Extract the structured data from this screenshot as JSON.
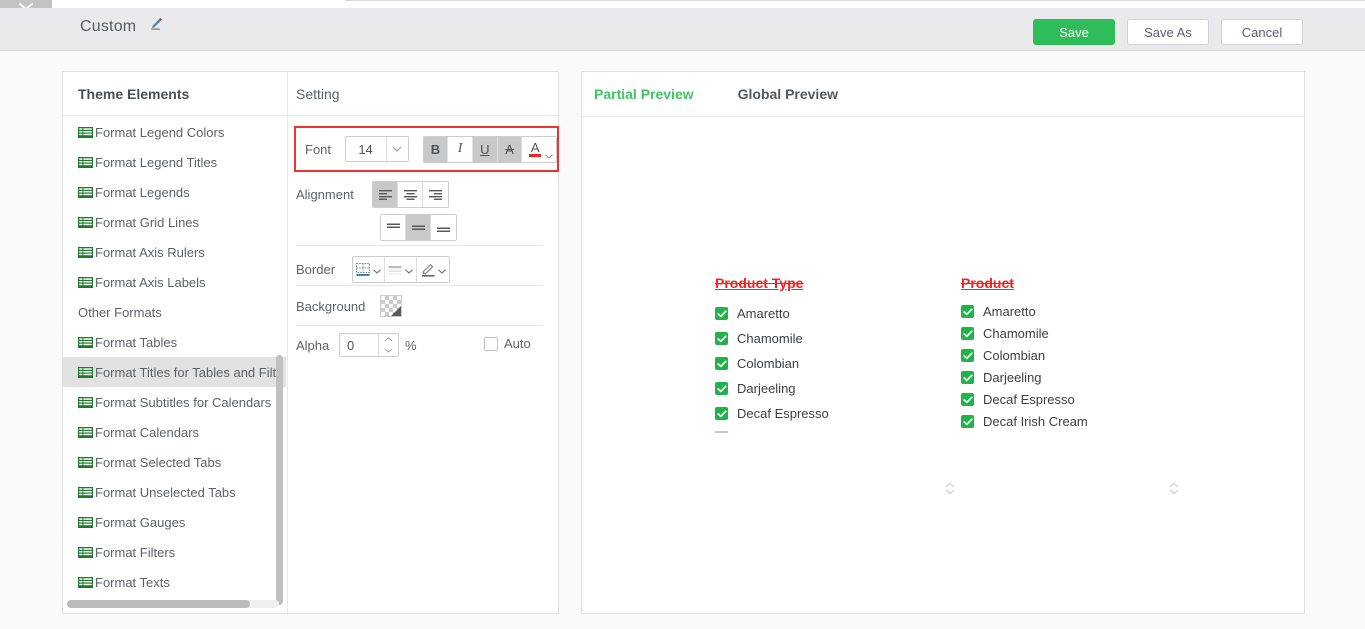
{
  "window": {
    "ghost_tab_icon": "chevron-down-icon"
  },
  "header": {
    "title": "Custom",
    "edit_icon": "pencil-icon",
    "buttons": {
      "save": "Save",
      "save_as": "Save As",
      "cancel": "Cancel"
    },
    "accent_green": "#2ebd59"
  },
  "left_panel": {
    "theme_header": "Theme Elements",
    "setting_header": "Setting",
    "items": [
      {
        "label": "Format Legend Colors",
        "icon": "list-format-icon",
        "selected": false,
        "has_icon": true
      },
      {
        "label": "Format Legend Titles",
        "icon": "list-format-icon",
        "selected": false,
        "has_icon": true
      },
      {
        "label": "Format Legends",
        "icon": "list-format-icon",
        "selected": false,
        "has_icon": true
      },
      {
        "label": "Format Grid Lines",
        "icon": "list-format-icon",
        "selected": false,
        "has_icon": true
      },
      {
        "label": "Format Axis Rulers",
        "icon": "list-format-icon",
        "selected": false,
        "has_icon": true
      },
      {
        "label": "Format Axis Labels",
        "icon": "list-format-icon",
        "selected": false,
        "has_icon": true
      },
      {
        "label": "Other Formats",
        "icon": "",
        "selected": false,
        "has_icon": false
      },
      {
        "label": "Format Tables",
        "icon": "list-format-icon",
        "selected": false,
        "has_icon": true
      },
      {
        "label": "Format Titles for Tables and Filt",
        "icon": "list-format-icon",
        "selected": true,
        "has_icon": true
      },
      {
        "label": "Format Subtitles for Calendars",
        "icon": "list-format-icon",
        "selected": false,
        "has_icon": true
      },
      {
        "label": "Format Calendars",
        "icon": "list-format-icon",
        "selected": false,
        "has_icon": true
      },
      {
        "label": "Format Selected Tabs",
        "icon": "list-format-icon",
        "selected": false,
        "has_icon": true
      },
      {
        "label": "Format Unselected Tabs",
        "icon": "list-format-icon",
        "selected": false,
        "has_icon": true
      },
      {
        "label": "Format Gauges",
        "icon": "list-format-icon",
        "selected": false,
        "has_icon": true
      },
      {
        "label": "Format Filters",
        "icon": "list-format-icon",
        "selected": false,
        "has_icon": true
      },
      {
        "label": "Format Texts",
        "icon": "list-format-icon",
        "selected": false,
        "has_icon": true
      }
    ]
  },
  "settings": {
    "font": {
      "label": "Font",
      "size_value": "14",
      "dropdown_icon": "chevron-down-icon",
      "bold": {
        "glyph": "B",
        "name": "bold-button",
        "active": true
      },
      "italic": {
        "glyph": "I",
        "name": "italic-button",
        "active": false
      },
      "underline": {
        "glyph": "U",
        "name": "underline-button",
        "active": true
      },
      "strikethrough": {
        "glyph": "A",
        "name": "strikethrough-button",
        "active": true
      },
      "text_color": {
        "glyph": "A",
        "name": "text-color-button",
        "color": "#ee2222",
        "active": false
      },
      "highlight_color": "#f0322e"
    },
    "alignment": {
      "label": "Alignment",
      "horizontal": [
        {
          "name": "align-left-button",
          "active": true
        },
        {
          "name": "align-center-button",
          "active": false
        },
        {
          "name": "align-right-button",
          "active": false
        }
      ],
      "vertical": [
        {
          "name": "align-top-button",
          "active": false
        },
        {
          "name": "align-middle-button",
          "active": true
        },
        {
          "name": "align-bottom-button",
          "active": false
        }
      ]
    },
    "border": {
      "label": "Border",
      "buttons": [
        {
          "name": "border-style-grid-button",
          "icon": "border-grid-icon"
        },
        {
          "name": "border-line-weight-button",
          "icon": "line-style-icon"
        },
        {
          "name": "border-color-button",
          "icon": "pen-color-icon"
        }
      ]
    },
    "background": {
      "label": "Background",
      "swatch_name": "background-color-swatch"
    },
    "alpha": {
      "label": "Alpha",
      "value": "0",
      "unit": "%",
      "auto_label": "Auto",
      "auto_checked": false
    }
  },
  "preview": {
    "tabs": [
      {
        "label": "Partial Preview",
        "active": true
      },
      {
        "label": "Global Preview",
        "active": false
      }
    ],
    "columns": [
      {
        "title": "Product Type",
        "items": [
          "Amaretto",
          "Chamomile",
          "Colombian",
          "Darjeeling",
          "Decaf Espresso"
        ],
        "truncated": true
      },
      {
        "title": "Product",
        "items": [
          "Amaretto",
          "Chamomile",
          "Colombian",
          "Darjeeling",
          "Decaf Espresso",
          "Decaf Irish Cream"
        ],
        "truncated": false
      }
    ],
    "title_color": "#fa2020",
    "checkbox_color": "#21b34a"
  }
}
